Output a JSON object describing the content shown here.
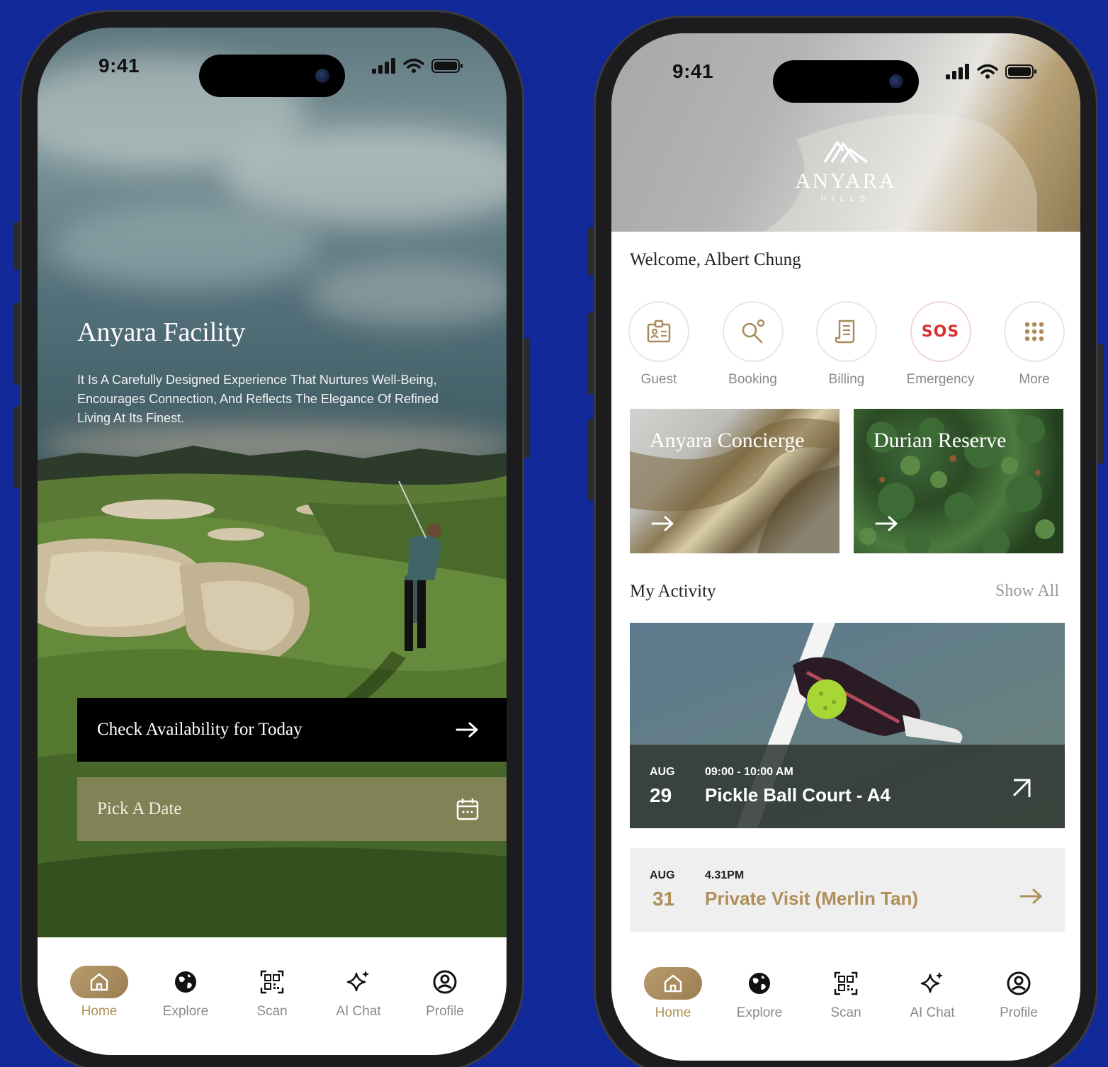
{
  "status": {
    "time": "9:41"
  },
  "left": {
    "title": "Anyara Facility",
    "description": "It Is A Carefully Designed Experience That Nurtures Well-Being, Encourages Connection, And Reflects The Elegance Of Refined Living At Its Finest.",
    "check_label": "Check Availability for Today",
    "date_label": "Pick A Date"
  },
  "right": {
    "brand": {
      "name": "ANYARA",
      "sub": "HILLS"
    },
    "welcome": "Welcome, Albert Chung",
    "quick": [
      {
        "label": "Guest",
        "icon": "id-card-icon"
      },
      {
        "label": "Booking",
        "icon": "key-search-icon"
      },
      {
        "label": "Billing",
        "icon": "receipt-icon"
      },
      {
        "label": "Emergency",
        "icon": "sos-icon",
        "glyph": "SOS"
      },
      {
        "label": "More",
        "icon": "grid-dots-icon"
      }
    ],
    "cards": [
      {
        "title": "Anyara Concierge"
      },
      {
        "title": "Durian Reserve"
      }
    ],
    "activity_title": "My Activity",
    "show_all": "Show All",
    "activities": [
      {
        "month": "AUG",
        "day": "29",
        "time": "09:00 - 10:00 AM",
        "title": "Pickle Ball Court - A4"
      },
      {
        "month": "AUG",
        "day": "31",
        "time": "4.31PM",
        "title": "Private Visit (Merlin Tan)"
      }
    ]
  },
  "nav": [
    {
      "label": "Home",
      "icon": "home-icon",
      "active": true
    },
    {
      "label": "Explore",
      "icon": "globe-icon"
    },
    {
      "label": "Scan",
      "icon": "qr-icon"
    },
    {
      "label": "AI Chat",
      "icon": "sparkle-icon"
    },
    {
      "label": "Profile",
      "icon": "profile-icon"
    }
  ],
  "colors": {
    "background": "#12299a",
    "gold": "#b08f5a",
    "sos_red": "#d93030"
  }
}
